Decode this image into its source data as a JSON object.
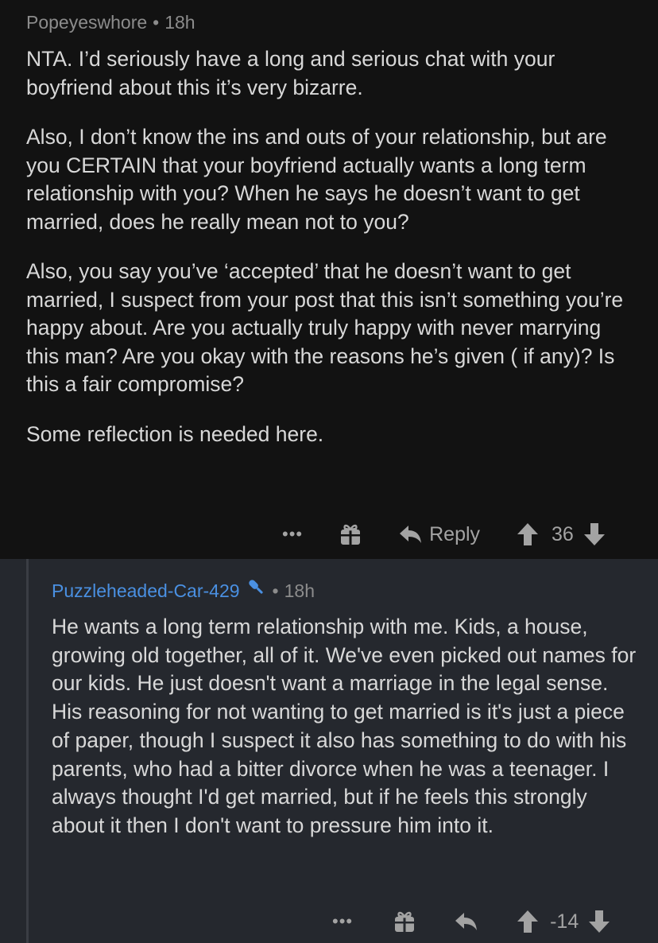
{
  "parent_comment": {
    "author": "Popeyeswhore",
    "separator": "•",
    "time": "18h",
    "paragraphs": [
      "NTA. I’d seriously have a long and serious chat with your boyfriend about this it’s very bizarre.",
      "Also, I don’t know the ins and outs of your relationship, but are you CERTAIN that your boyfriend actually wants a long term relationship with you? When he says he doesn’t want to get married, does he really mean not to you?",
      "Also, you say you’ve ‘accepted’ that he doesn’t want to get married, I suspect from your post that this isn’t something you’re happy about. Are you actually truly happy with never marrying this man? Are you okay with the reasons he’s given ( if any)? Is this a fair compromise?",
      "Some reflection is needed here."
    ],
    "actions": {
      "more_label": "•••",
      "award_icon": "gift-icon",
      "reply_label": "Reply",
      "upvote_icon": "arrow-up-icon",
      "score": "36",
      "downvote_icon": "arrow-down-icon"
    }
  },
  "reply_comment": {
    "author": "Puzzleheaded-Car-429",
    "author_icon": "microphone-icon",
    "separator": "•",
    "time": "18h",
    "body": "He wants a long term relationship with me. Kids, a house, growing old together, all of it. We've even picked out names for our kids. He just doesn't want a marriage in the legal sense. His reasoning for not wanting to get married is it's just a piece of paper, though I suspect it also has something to do with his parents, who had a bitter divorce when he was a teenager. I always thought I'd get married, but if he feels this strongly about it then I don't want to pressure him into it.",
    "actions": {
      "more_label": "•••",
      "award_icon": "gift-icon",
      "reply_icon": "reply-arrow-icon",
      "upvote_icon": "arrow-up-icon",
      "score": "-14",
      "downvote_icon": "arrow-down-icon"
    }
  },
  "colors": {
    "background_parent": "#121212",
    "background_reply": "#25282e",
    "text": "#d8d8d8",
    "meta": "#8c8c8c",
    "author_link": "#4a90e2",
    "action": "#a3a3a3"
  }
}
